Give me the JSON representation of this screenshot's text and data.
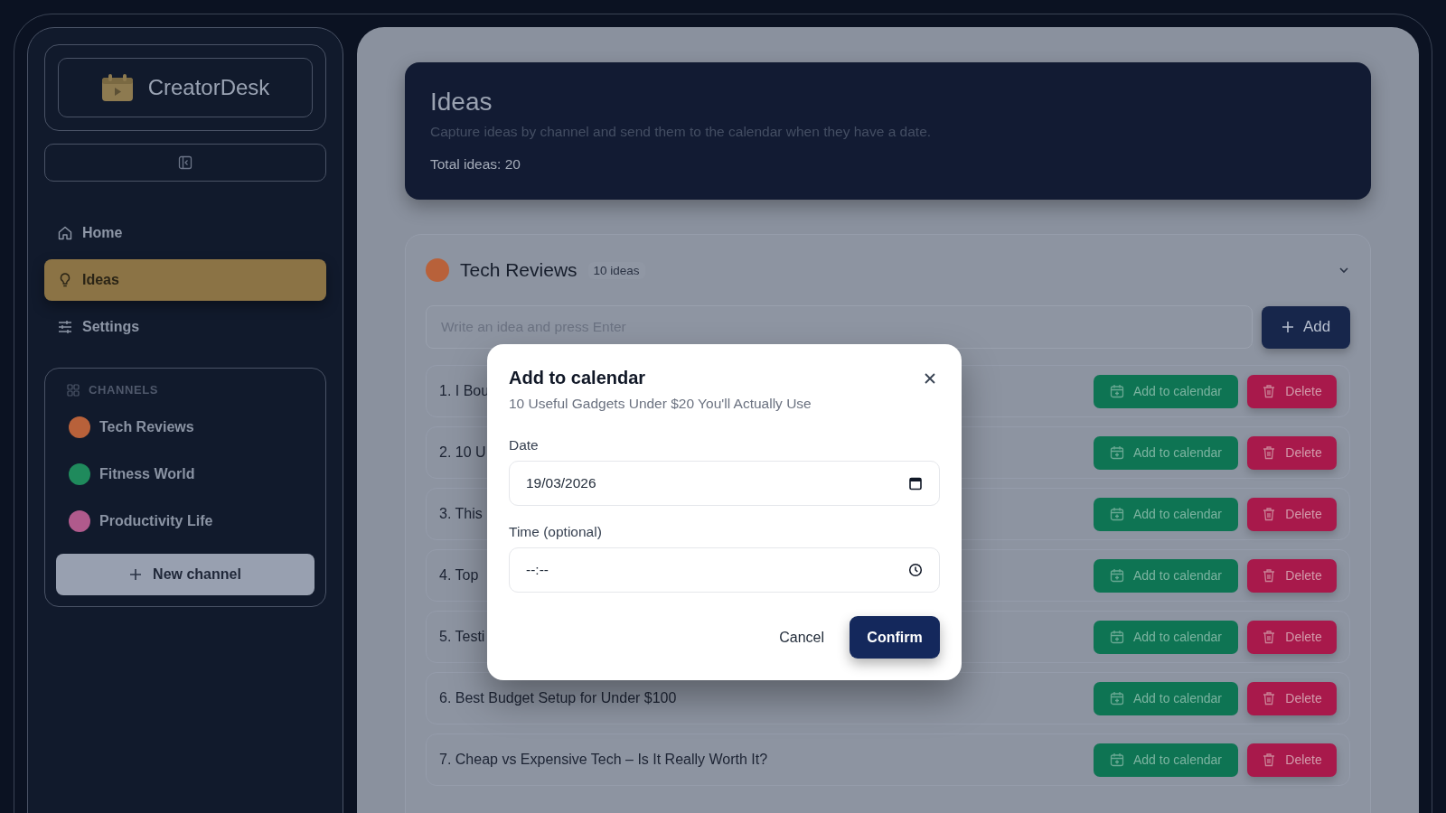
{
  "app": {
    "name": "CreatorDesk"
  },
  "nav": [
    {
      "label": "Home",
      "kind": "home",
      "selected": false
    },
    {
      "label": "Ideas",
      "kind": "ideas",
      "selected": true
    },
    {
      "label": "Settings",
      "kind": "settings",
      "selected": false
    }
  ],
  "channels": {
    "heading": "CHANNELS",
    "items": [
      {
        "name": "Tech Reviews",
        "color": "#b8613a"
      },
      {
        "name": "Fitness World",
        "color": "#1f8a5c"
      },
      {
        "name": "Productivity Life",
        "color": "#b05a8c"
      }
    ],
    "new_button": "New channel"
  },
  "header": {
    "title": "Ideas",
    "subtitle": "Capture ideas by channel and send them to the calendar when they have a date.",
    "total": "Total ideas: 20"
  },
  "section": {
    "title": "Tech Reviews",
    "count": "10 ideas",
    "color": "#b8613a",
    "placeholder": "Write an idea and press Enter",
    "add_button": "Add"
  },
  "ideas": [
    {
      "title": "1. I Bou",
      "add_label": "Add to calendar",
      "delete_label": "Delete"
    },
    {
      "title": "2. 10 U",
      "add_label": "Add to calendar",
      "delete_label": "Delete"
    },
    {
      "title": "3. This",
      "add_label": "Add to calendar",
      "delete_label": "Delete"
    },
    {
      "title": "4. Top",
      "add_label": "Add to calendar",
      "delete_label": "Delete"
    },
    {
      "title": "5. Testi",
      "add_label": "Add to calendar",
      "delete_label": "Delete"
    },
    {
      "title": "6. Best Budget Setup for Under $100",
      "add_label": "Add to calendar",
      "delete_label": "Delete"
    },
    {
      "title": "7. Cheap vs Expensive Tech – Is It Really Worth It?",
      "add_label": "Add to calendar",
      "delete_label": "Delete"
    }
  ],
  "modal": {
    "title": "Add to calendar",
    "subtitle": "10 Useful Gadgets Under $20 You'll Actually Use",
    "fields": [
      {
        "label": "Date",
        "value": "19/03/2026",
        "kind": "date"
      },
      {
        "label": "Time (optional)",
        "value": "--:--",
        "kind": "time"
      }
    ],
    "cancel": "Cancel",
    "confirm": "Confirm"
  }
}
